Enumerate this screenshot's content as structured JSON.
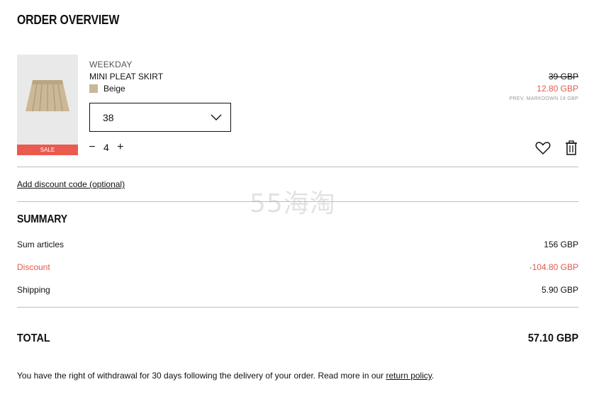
{
  "page": {
    "title": "ORDER OVERVIEW"
  },
  "item": {
    "brand": "WEEKDAY",
    "name": "MINI PLEAT SKIRT",
    "color": "Beige",
    "color_hex": "#c9b79a",
    "sale_badge": "SALE",
    "size": "38",
    "quantity": "4",
    "qty_minus": "−",
    "qty_plus": "+",
    "original_price": "39 GBP",
    "price": "12.80 GBP",
    "prev_markdown": "PREV. MARKDOWN 18 GBP"
  },
  "discount": {
    "link_label": "Add discount code (optional)"
  },
  "summary": {
    "title": "SUMMARY",
    "rows": [
      {
        "label": "Sum articles",
        "value": "156 GBP"
      },
      {
        "label": "Discount",
        "value": "-104.80 GBP"
      },
      {
        "label": "Shipping",
        "value": "5.90 GBP"
      }
    ],
    "total_label": "TOTAL",
    "total_value": "57.10 GBP"
  },
  "footer": {
    "text": "You have the right of withdrawal for 30 days following the delivery of your order. Read more in our ",
    "link": "return policy",
    "suffix": "."
  },
  "watermark": "55海淘",
  "colors": {
    "sale": "#ea5a4f",
    "discount": "#e05a4e"
  },
  "icons": [
    "chevron-down-icon",
    "heart-icon",
    "trash-icon"
  ]
}
